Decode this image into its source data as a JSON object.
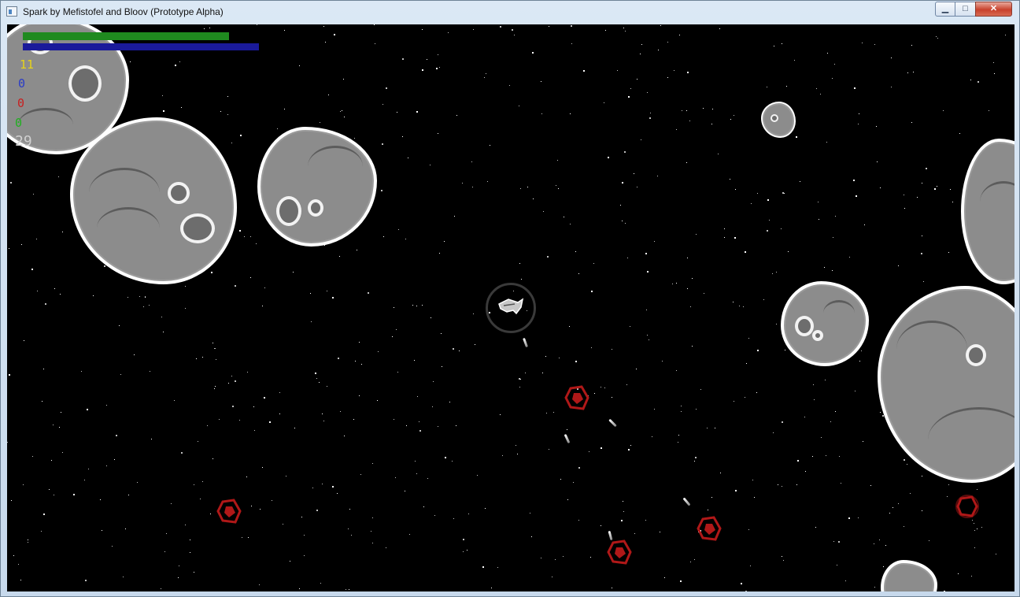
{
  "window": {
    "title": "Spark by Mefistofel and Bloov (Prototype Alpha)",
    "controls": {
      "minimize": "▁",
      "maximize": "□",
      "close": "✕"
    }
  },
  "hud": {
    "health_fraction": 1.0,
    "energy_fraction": 1.0,
    "counters": {
      "yellow": "11",
      "blue": "0",
      "red": "0",
      "green": "0",
      "white": "29"
    },
    "colors": {
      "yellow": "#e6d21a",
      "blue": "#2a3cc8",
      "red": "#c82020",
      "green": "#20b020",
      "white": "#d0d0d0"
    }
  },
  "scene": {
    "background_color": "#000000",
    "asteroid_color": "#8c8c8c",
    "enemy_color": "#b01818",
    "player_ship_icon": "spaceship-icon",
    "enemy_icon": "alien-fighter-icon"
  }
}
